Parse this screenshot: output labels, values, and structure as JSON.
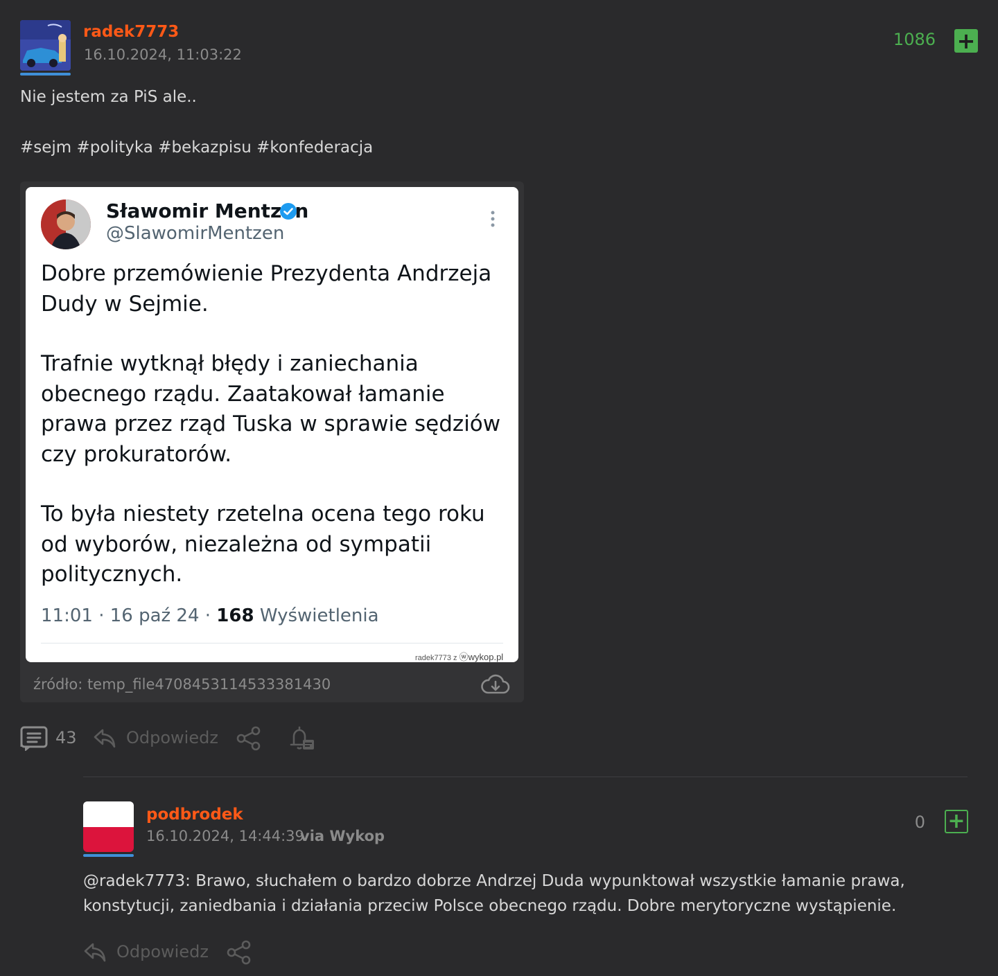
{
  "entry": {
    "author": "radek7773",
    "date": "16.10.2024, 11:03:22",
    "votes": "1086",
    "plus_icon": "plus-icon",
    "body": "Nie jestem za PiS ale..",
    "tags": "#sejm #polityka #bekazpisu #konfederacja",
    "source": "źródło: temp_file4708453114533381430",
    "comments_count": "43",
    "reply_label": "Odpowiedz"
  },
  "tweet": {
    "name": "Sławomir Mentzen",
    "handle": "@SlawomirMentzen",
    "paragraph1": "Dobre przemówienie Prezydenta Andrzeja Dudy w Sejmie.",
    "paragraph2": "Trafnie wytknął błędy i zaniechania obecnego rządu. Zaatakował łamanie prawa przez rząd Tuska w sprawie sędziów czy prokuratorów.",
    "paragraph3": "To była niestety rzetelna ocena tego roku od wyborów, niezależna od sympatii politycznych.",
    "meta_time": "11:01 · 16 paź 24 · ",
    "views_count": "168",
    "views_label": " Wyświetlenia",
    "watermark_user": "radek7773  z",
    "watermark_site": "ⓦwykop.pl"
  },
  "comment": {
    "author": "podbrodek",
    "date": "16.10.2024, 14:44:39",
    "via": "via Wykop",
    "votes": "0",
    "mention": "@radek7773",
    "text": ": Brawo, słuchałem o bardzo dobrze Andrzej Duda wypunktował wszystkie łamanie prawa, konstytucji, zaniedbania i działania przeciw Polsce obecnego rządu. Dobre merytoryczne wystąpienie.",
    "reply_label": "Odpowiedz"
  },
  "colors": {
    "background": "#2a2a2c",
    "author": "#ff5917",
    "vote_positive": "#4caf50",
    "avatar_bar": "#3f8fd8"
  }
}
